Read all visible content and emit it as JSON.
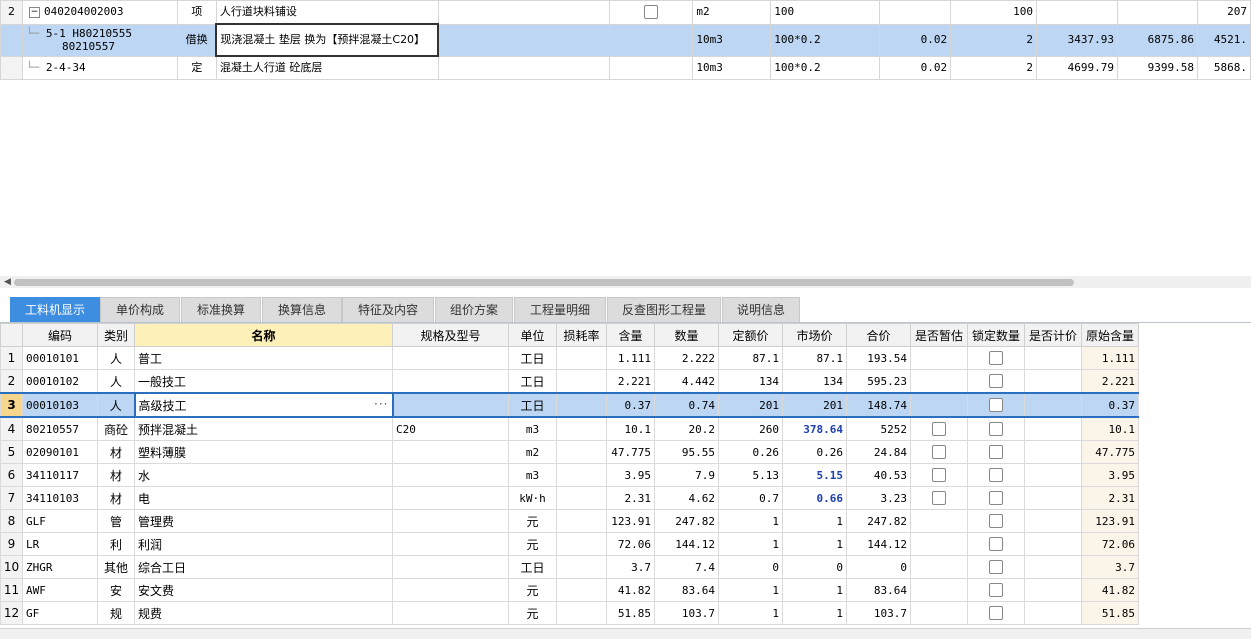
{
  "top_rows": [
    {
      "row_no": "2",
      "code": "040204002003",
      "type": "项",
      "name": "人行道块料铺设",
      "unit": "m2",
      "qty_expr": "100",
      "qty": "100",
      "partial": "207"
    },
    {
      "code_line1": "5-1 H80210555",
      "code_line2": "80210557",
      "type": "借换",
      "name": "现浇混凝土 垫层  换为【预拌混凝土C20】",
      "unit": "10m3",
      "qty_expr": "100*0.2",
      "content": "0.02",
      "qty": "2",
      "unit_price": "3437.93",
      "total": "6875.86",
      "partial": "4521."
    },
    {
      "code": "2-4-34",
      "type": "定",
      "name": "混凝土人行道 砼底层",
      "unit": "10m3",
      "qty_expr": "100*0.2",
      "content": "0.02",
      "qty": "2",
      "unit_price": "4699.79",
      "total": "9399.58",
      "partial": "5868."
    }
  ],
  "tabs": [
    "工料机显示",
    "单价构成",
    "标准换算",
    "换算信息",
    "特征及内容",
    "组价方案",
    "工程量明细",
    "反查图形工程量",
    "说明信息"
  ],
  "columns": [
    "编码",
    "类别",
    "名称",
    "规格及型号",
    "单位",
    "损耗率",
    "含量",
    "数量",
    "定额价",
    "市场价",
    "合价",
    "是否暂估",
    "锁定数量",
    "是否计价",
    "原始含量"
  ],
  "rows": [
    {
      "no": "1",
      "code": "00010101",
      "type": "人",
      "name": "普工",
      "spec": "",
      "unit": "工日",
      "content": "1.111",
      "qty": "2.222",
      "quota": "87.1",
      "market": "87.1",
      "total": "193.54",
      "est": false,
      "orig": "1.111"
    },
    {
      "no": "2",
      "code": "00010102",
      "type": "人",
      "name": "一般技工",
      "spec": "",
      "unit": "工日",
      "content": "2.221",
      "qty": "4.442",
      "quota": "134",
      "market": "134",
      "total": "595.23",
      "est": false,
      "orig": "2.221"
    },
    {
      "no": "3",
      "code": "00010103",
      "type": "人",
      "name": "高级技工",
      "spec": "",
      "unit": "工日",
      "content": "0.37",
      "qty": "0.74",
      "quota": "201",
      "market": "201",
      "total": "148.74",
      "est": false,
      "orig": "0.37"
    },
    {
      "no": "4",
      "code": "80210557",
      "type": "商砼",
      "name": "预拌混凝土",
      "spec": "C20",
      "unit": "m3",
      "content": "10.1",
      "qty": "20.2",
      "quota": "260",
      "market": "378.64",
      "total": "5252",
      "est": true,
      "orig": "10.1"
    },
    {
      "no": "5",
      "code": "02090101",
      "type": "材",
      "name": "塑料薄膜",
      "spec": "",
      "unit": "m2",
      "content": "47.775",
      "qty": "95.55",
      "quota": "0.26",
      "market": "0.26",
      "total": "24.84",
      "est": true,
      "orig": "47.775"
    },
    {
      "no": "6",
      "code": "34110117",
      "type": "材",
      "name": "水",
      "spec": "",
      "unit": "m3",
      "content": "3.95",
      "qty": "7.9",
      "quota": "5.13",
      "market": "5.15",
      "total": "40.53",
      "est": true,
      "orig": "3.95"
    },
    {
      "no": "7",
      "code": "34110103",
      "type": "材",
      "name": "电",
      "spec": "",
      "unit": "kW·h",
      "content": "2.31",
      "qty": "4.62",
      "quota": "0.7",
      "market": "0.66",
      "total": "3.23",
      "est": true,
      "orig": "2.31"
    },
    {
      "no": "8",
      "code": "GLF",
      "type": "管",
      "name": "管理费",
      "spec": "",
      "unit": "元",
      "content": "123.91",
      "qty": "247.82",
      "quota": "1",
      "market": "1",
      "total": "247.82",
      "est": false,
      "orig": "123.91"
    },
    {
      "no": "9",
      "code": "LR",
      "type": "利",
      "name": "利润",
      "spec": "",
      "unit": "元",
      "content": "72.06",
      "qty": "144.12",
      "quota": "1",
      "market": "1",
      "total": "144.12",
      "est": false,
      "orig": "72.06"
    },
    {
      "no": "10",
      "code": "ZHGR",
      "type": "其他",
      "name": "综合工日",
      "spec": "",
      "unit": "工日",
      "content": "3.7",
      "qty": "7.4",
      "quota": "0",
      "market": "0",
      "total": "0",
      "est": false,
      "orig": "3.7"
    },
    {
      "no": "11",
      "code": "AWF",
      "type": "安",
      "name": "安文费",
      "spec": "",
      "unit": "元",
      "content": "41.82",
      "qty": "83.64",
      "quota": "1",
      "market": "1",
      "total": "83.64",
      "est": false,
      "orig": "41.82"
    },
    {
      "no": "12",
      "code": "GF",
      "type": "规",
      "name": "规费",
      "spec": "",
      "unit": "元",
      "content": "51.85",
      "qty": "103.7",
      "quota": "1",
      "market": "1",
      "total": "103.7",
      "est": false,
      "orig": "51.85"
    }
  ],
  "colors": {
    "accent": "#3d8ee0",
    "selection": "#bcd6f3",
    "market_changed": "#1d3fb0"
  }
}
